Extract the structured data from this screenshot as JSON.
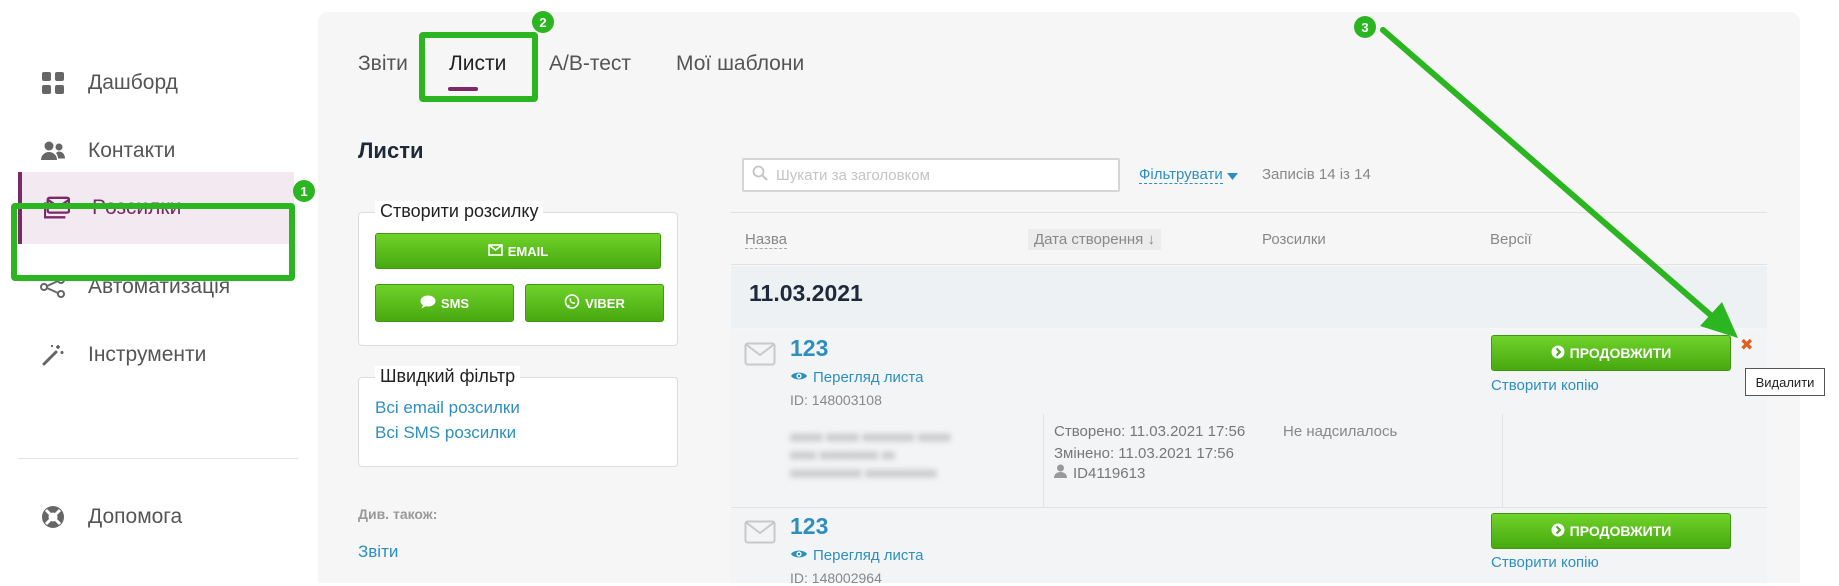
{
  "sidebar": {
    "items": [
      {
        "label": "Дашборд",
        "icon": "grid-icon"
      },
      {
        "label": "Контакти",
        "icon": "users-icon"
      },
      {
        "label": "Розсилки",
        "icon": "mail-stack-icon"
      },
      {
        "label": "Автоматизація",
        "icon": "share-nodes-icon"
      },
      {
        "label": "Інструменти",
        "icon": "magic-wand-icon"
      }
    ],
    "help_label": "Допомога"
  },
  "tabs": [
    {
      "label": "Звіти"
    },
    {
      "label": "Листи"
    },
    {
      "label": "A/B-тест"
    },
    {
      "label": "Мої шаблони"
    }
  ],
  "page_title": "Листи",
  "create_card": {
    "legend": "Створити розсилку",
    "email_label": "EMAIL",
    "sms_label": "SMS",
    "viber_label": "VIBER"
  },
  "filter_card": {
    "legend": "Швидкий фільтр",
    "links": [
      "Всі email розсилки",
      "Всі SMS розсилки"
    ]
  },
  "see_also": {
    "label": "Див. також:",
    "link": "Звіти"
  },
  "search": {
    "placeholder": "Шукати за заголовком"
  },
  "filter_label": "Фільтрувати",
  "records_count": "Записів 14 із 14",
  "table": {
    "headers": [
      "Назва",
      "Дата створення ↓",
      "Розсилки",
      "Версії"
    ],
    "date_group": "11.03.2021",
    "rows": [
      {
        "title": "123",
        "preview": "Перегляд листа",
        "id": "ID: 148003108",
        "created": "Створено: 11.03.2021 17:56",
        "modified": "Змінено: 11.03.2021 17:56",
        "author": "ID4119613",
        "status": "Не надсилалось",
        "continue_label": "ПРОДОВЖИТИ",
        "copy_label": "Створити копію",
        "blurred_lines": [
          "xxxxx xxxxx xxxxxxxx xxxxx",
          "xxxx xxxxxxxxx xx",
          "xxxxxxxxxxx xxxxxxxxxxx"
        ]
      },
      {
        "title": "123",
        "preview": "Перегляд листа",
        "id": "ID: 148002964",
        "continue_label": "ПРОДОВЖИТИ",
        "copy_label": "Створити копію"
      }
    ]
  },
  "delete_tooltip": "Видалити",
  "annotations": [
    {
      "n": "1"
    },
    {
      "n": "2"
    },
    {
      "n": "3"
    }
  ],
  "colors": {
    "accent": "#7b2969",
    "green": "#2bb520",
    "link": "#2e8fbf",
    "delete": "#e0611e"
  }
}
